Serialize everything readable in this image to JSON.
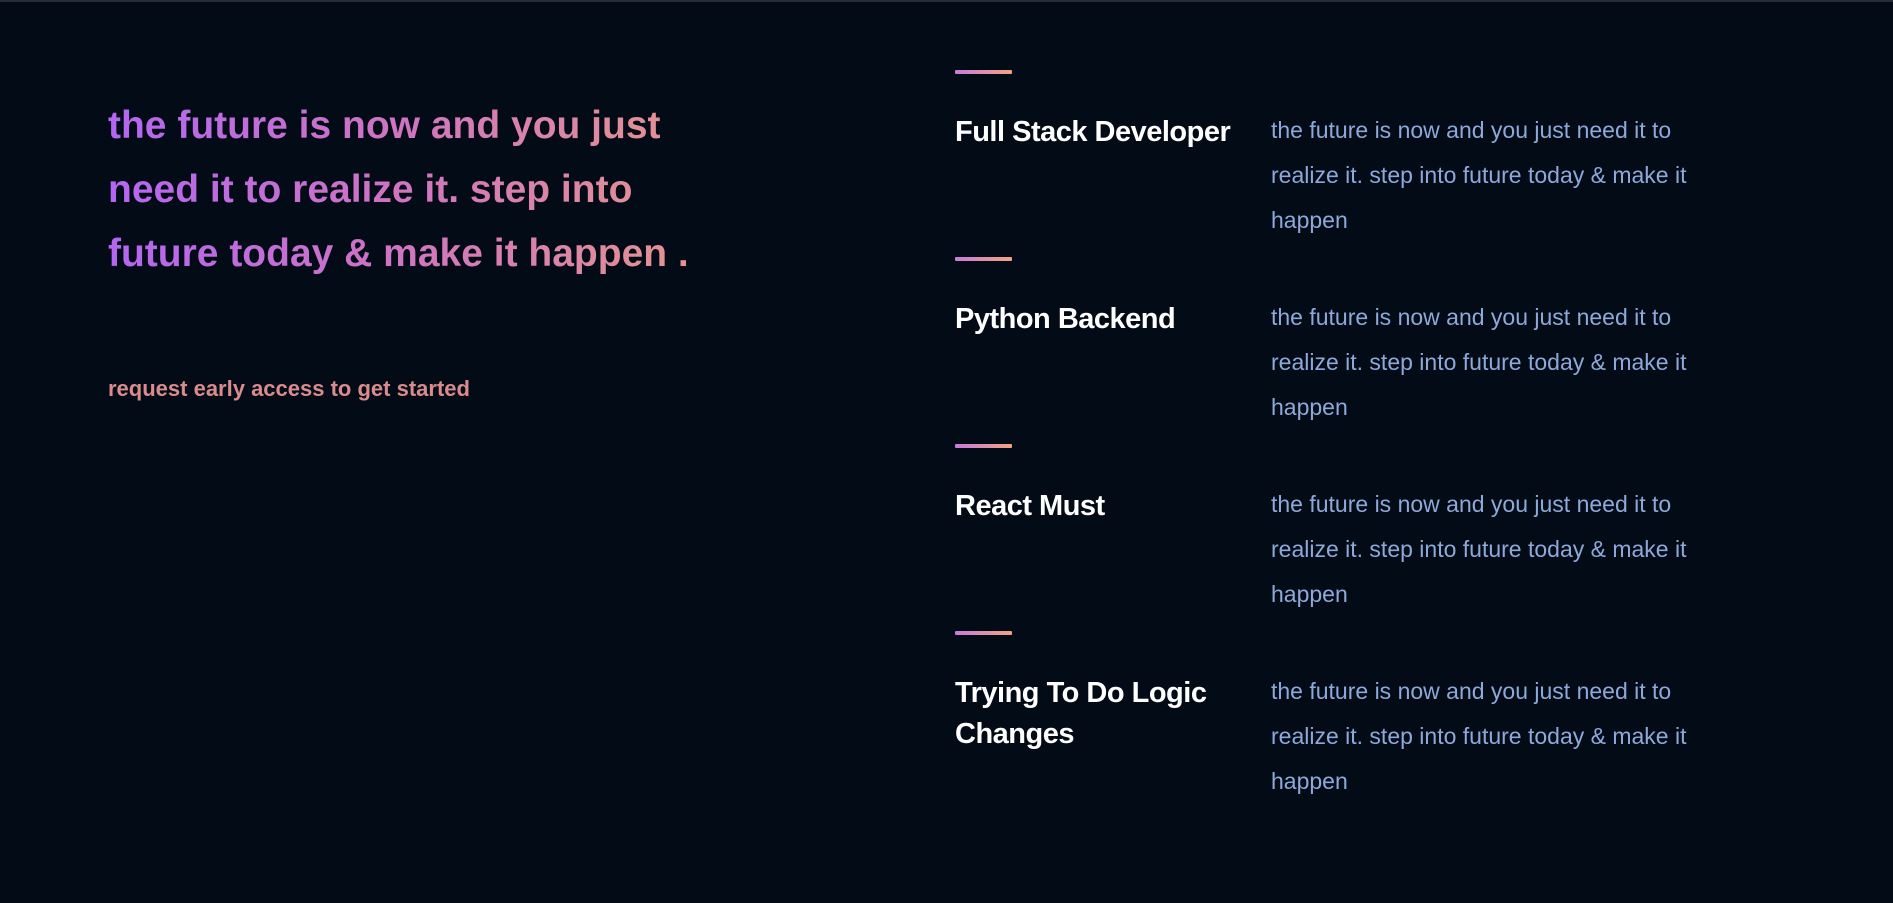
{
  "hero": {
    "heading": "the future is now and you just need it to realize it. step into future today & make it happen .",
    "cta": "request early access to get started"
  },
  "features": [
    {
      "title": "Full Stack Developer",
      "description": "the future is now and you just need it to realize it. step into future today & make it happen"
    },
    {
      "title": "Python Backend",
      "description": "the future is now and you just need it to realize it. step into future today & make it happen"
    },
    {
      "title": "React Must",
      "description": "the future is now and you just need it to realize it. step into future today & make it happen"
    },
    {
      "title": "Trying To Do Logic Changes",
      "description": "the future is now and you just need it to realize it. step into future today & make it happen"
    }
  ],
  "colors": {
    "background": "#030b17",
    "heading_gradient_start": "#b366f2",
    "heading_gradient_end": "#e89a86",
    "cta": "#d98b8d",
    "feature_title": "#ffffff",
    "feature_description": "#8da9da",
    "divider_start": "#c67bdc",
    "divider_end": "#f4a27f"
  }
}
